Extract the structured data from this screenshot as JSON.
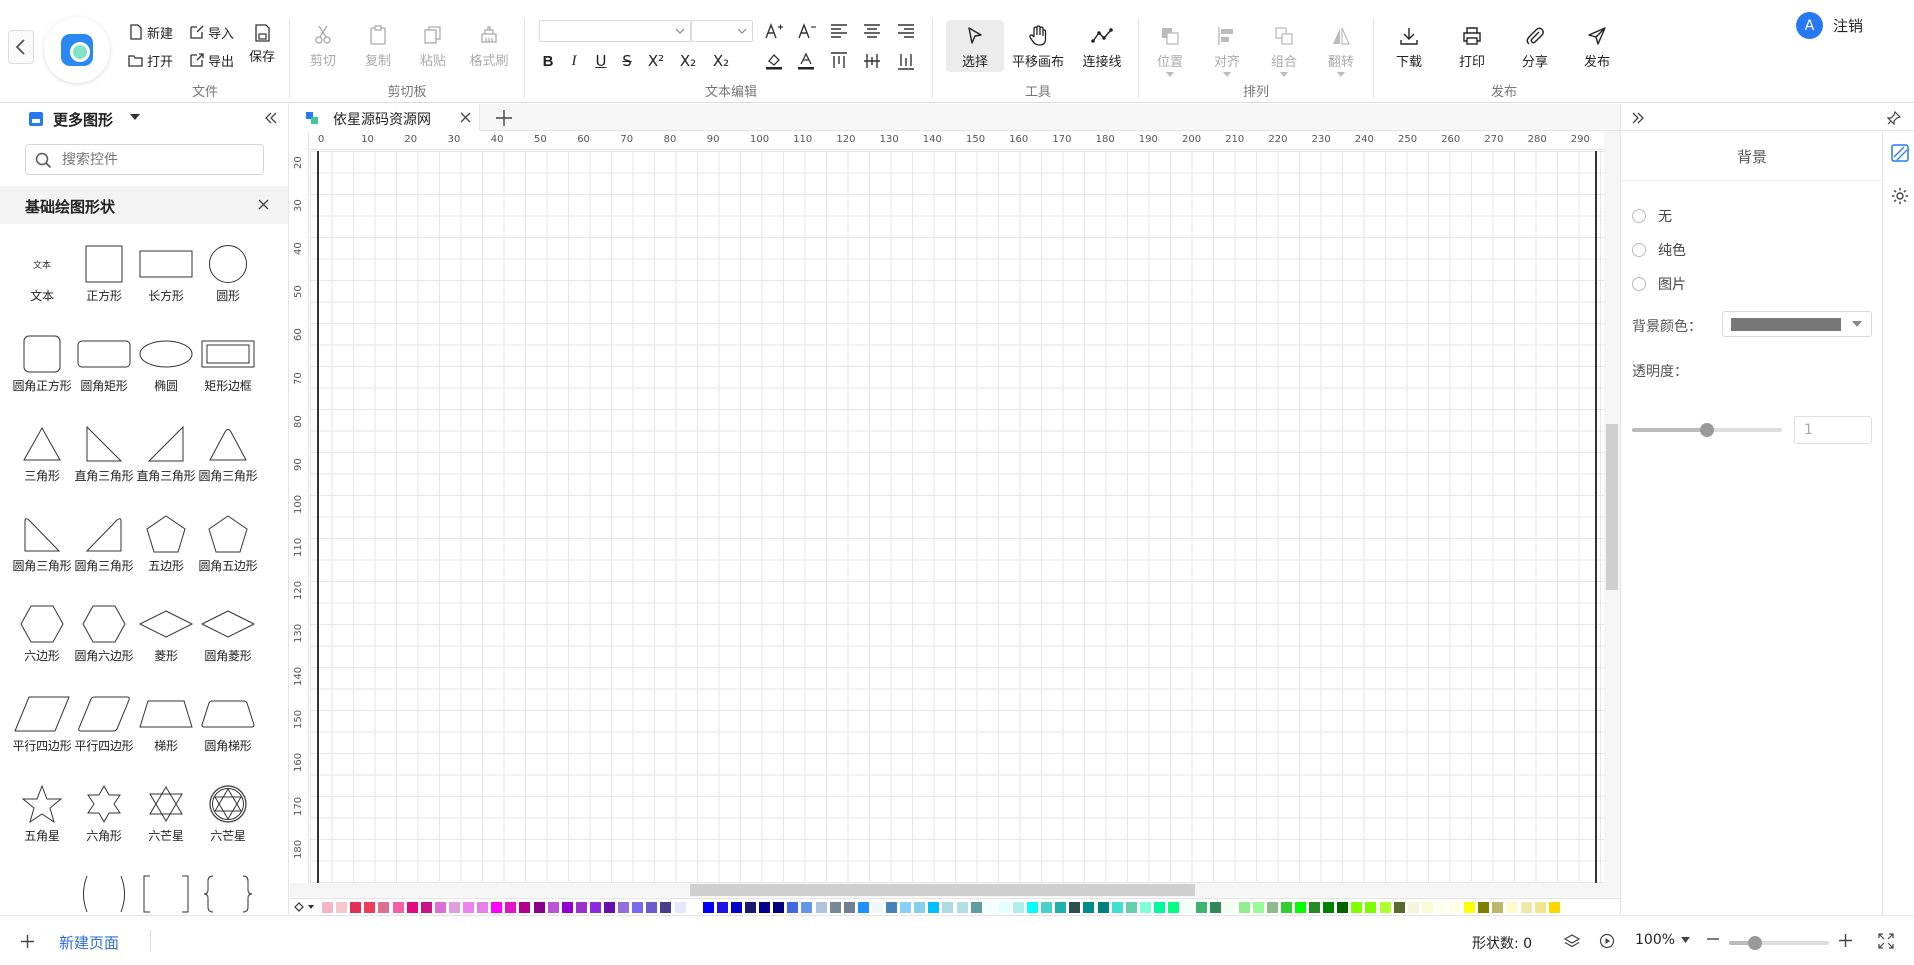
{
  "toolbar": {
    "file": {
      "label": "文件",
      "new": "新建",
      "import": "导入",
      "save": "保存",
      "open": "打开",
      "export": "导出"
    },
    "clipboard": {
      "label": "剪切板",
      "cut": "剪切",
      "copy": "复制",
      "paste": "粘贴",
      "format_painter": "格式刷"
    },
    "text_edit": {
      "label": "文本编辑"
    },
    "tools": {
      "label": "工具",
      "select": "选择",
      "pan": "平移画布",
      "connector": "连接线"
    },
    "arrange": {
      "label": "排列",
      "position": "位置",
      "align": "对齐",
      "group": "组合",
      "flip": "翻转"
    },
    "publish": {
      "label": "发布",
      "download": "下载",
      "print": "打印",
      "share": "分享",
      "publish": "发布"
    },
    "user": {
      "avatar_letter": "A",
      "logout": "注销"
    }
  },
  "left_panel": {
    "title": "更多图形",
    "search_placeholder": "搜索控件",
    "section_title": "基础绘图形状",
    "shapes": [
      "文本",
      "正方形",
      "长方形",
      "圆形",
      "圆角正方形",
      "圆角矩形",
      "椭圆",
      "矩形边框",
      "三角形",
      "直角三角形",
      "直角三角形",
      "圆角三角形",
      "圆角三角形",
      "圆角三角形",
      "五边形",
      "圆角五边形",
      "六边形",
      "圆角六边形",
      "菱形",
      "圆角菱形",
      "平行四边形",
      "平行四边形",
      "梯形",
      "圆角梯形",
      "五角星",
      "六角形",
      "六芒星",
      "六芒星"
    ],
    "text_shape_glyph": "文本"
  },
  "tabs": [
    {
      "label": "依星源码资源网"
    }
  ],
  "ruler": {
    "top": [
      0,
      10,
      20,
      30,
      40,
      50,
      60,
      70,
      80,
      90,
      100,
      110,
      120,
      130,
      140,
      150,
      160,
      170,
      180,
      190,
      200,
      210,
      220,
      230,
      240,
      250,
      260,
      270,
      280,
      290
    ],
    "left": [
      20,
      30,
      40,
      50,
      60,
      70,
      80,
      90,
      100,
      110,
      120,
      130,
      140,
      150,
      160,
      170,
      180
    ]
  },
  "right_panel": {
    "title": "背景",
    "options": [
      "无",
      "纯色",
      "图片"
    ],
    "bg_color_label": "背景颜色：",
    "bg_color_value": "#777777",
    "opacity_label": "透明度：",
    "opacity_value": "1",
    "opacity_fraction": 0.5
  },
  "status": {
    "new_page": "新建页面",
    "shape_count": "形状数: 0",
    "zoom": "100%",
    "zoom_fraction": 0.26
  },
  "palette": [
    "#f4b6c2",
    "#f6c6cf",
    "#e03057",
    "#ef3d59",
    "#db7093",
    "#f55fa8",
    "#e5097f",
    "#c71585",
    "#da70d6",
    "#dda0dd",
    "#ee82ee",
    "#e87fe8",
    "#ff00ff",
    "#e013c7",
    "#b4008c",
    "#8b008b",
    "#ba55d3",
    "#9400d3",
    "#9932cc",
    "#8a2be2",
    "#6a0dad",
    "#9370db",
    "#7b68ee",
    "#6a5acd",
    "#483d8b",
    "#e6e6fa",
    "#ffffff",
    "#0000ff",
    "#1e10e6",
    "#0000cd",
    "#191970",
    "#00008b",
    "#000080",
    "#4169e1",
    "#6495ed",
    "#b0c4de",
    "#778899",
    "#708090",
    "#1e90ff",
    "#f0f8ff",
    "#4682b4",
    "#87cefa",
    "#87ceeb",
    "#00bfff",
    "#add8e6",
    "#b0e0e6",
    "#5f9ea0",
    "#f0ffff",
    "#e0ffff",
    "#afeeee",
    "#00ffff",
    "#48d1cc",
    "#20b2aa",
    "#2f4f4f",
    "#008b8b",
    "#008080",
    "#40e0d0",
    "#66cdaa",
    "#7fffd4",
    "#00fa9a",
    "#00ff7f",
    "#f5fffa",
    "#3cb371",
    "#2e8b57",
    "#f0fff0",
    "#90ee90",
    "#98fb98",
    "#8fbc8f",
    "#32cd32",
    "#00ff00",
    "#228b22",
    "#008000",
    "#006400",
    "#7fff00",
    "#7cfc00",
    "#adff2f",
    "#556b2f",
    "#f5f5dc",
    "#fafad2",
    "#fffff0",
    "#ffffe0",
    "#ffff00",
    "#808000",
    "#bdb76b",
    "#fffacd",
    "#eee8aa",
    "#f0e68c",
    "#ffd700"
  ]
}
